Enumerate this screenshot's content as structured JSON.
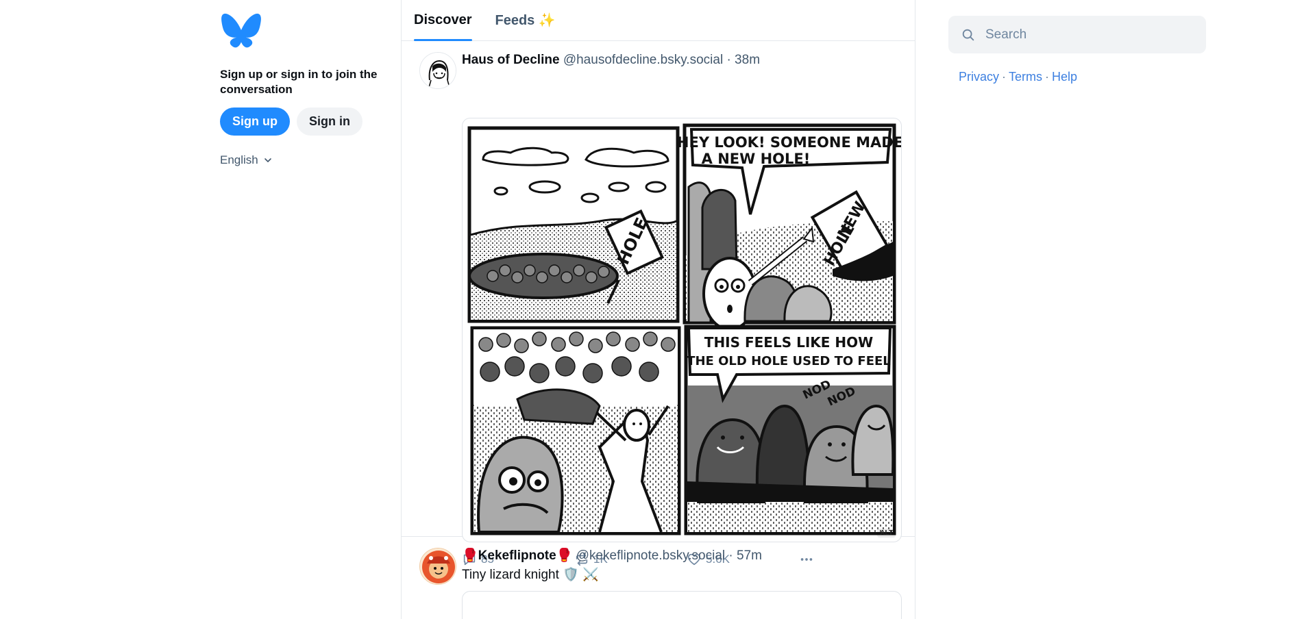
{
  "colors": {
    "accent": "#208bfe",
    "muted": "#6f869f",
    "border": "#e4e8ec"
  },
  "left": {
    "logo_icon": "butterfly-logo",
    "signin_prompt": "Sign up or sign in to join the conversation",
    "signup_label": "Sign up",
    "signin_label": "Sign in",
    "language": "English"
  },
  "tabs": [
    {
      "label": "Discover",
      "active": true
    },
    {
      "label": "Feeds ✨",
      "active": false
    }
  ],
  "posts": [
    {
      "display_name": "Haus of Decline",
      "handle": "@hausofdecline.bsky.social",
      "time": "· 38m",
      "comic": {
        "panel1_sign": "HOLE",
        "panel2_bubble_line1": "HEY LOOK! SOMEONE MADE",
        "panel2_bubble_line2": "A NEW HOLE!",
        "panel2_sign_line1": "NEW",
        "panel2_sign_line2": "HOLE",
        "panel4_bubble_line1": "THIS FEELS LIKE HOW",
        "panel4_bubble_line2": "THE OLD HOLE USED TO FEEL",
        "panel4_nod1": "NOD",
        "panel4_nod2": "NOD"
      },
      "alt_badge": "ALT",
      "replies": "85",
      "reposts": "1K",
      "likes": "5.6K"
    },
    {
      "display_name_prefix": "🥊",
      "display_name": "Kekeflipnote",
      "display_name_suffix": "🥊",
      "handle": "@kekeflipnote.bsky.social",
      "time": "· 57m",
      "text": "Tiny lizard knight 🛡️ ⚔️"
    }
  ],
  "right": {
    "search_placeholder": "Search",
    "links": [
      "Privacy",
      "Terms",
      "Help"
    ],
    "separator": "·"
  }
}
